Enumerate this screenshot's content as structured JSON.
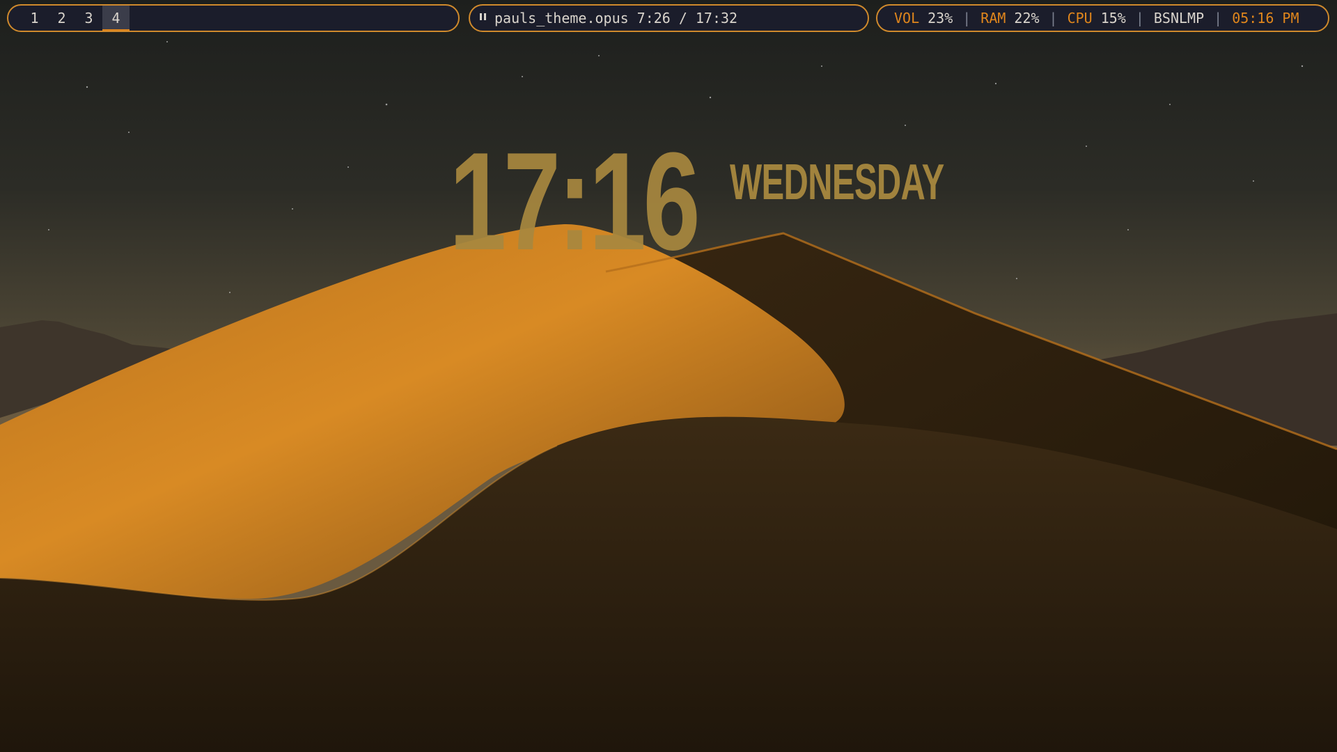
{
  "workspaces": [
    {
      "label": "1",
      "active": false
    },
    {
      "label": "2",
      "active": false
    },
    {
      "label": "3",
      "active": false
    },
    {
      "label": "4",
      "active": true
    }
  ],
  "media": {
    "status_icon": "pause-icon",
    "track": "pauls_theme.opus",
    "position": "7:26",
    "separator": "/",
    "duration": "17:32"
  },
  "status": {
    "vol_label": "VOL",
    "vol_value": "23%",
    "ram_label": "RAM",
    "ram_value": "22%",
    "cpu_label": "CPU",
    "cpu_value": "15%",
    "network": "BSNLMP",
    "time": "05:16 PM",
    "separator": "|"
  },
  "desktop_clock": {
    "time": "17:16",
    "day": "WEDNESDAY"
  },
  "colors": {
    "accent": "#e0861c",
    "bar_bg": "#1b1d2b",
    "bar_border": "#d08a2c",
    "clock": "#a8883f"
  }
}
